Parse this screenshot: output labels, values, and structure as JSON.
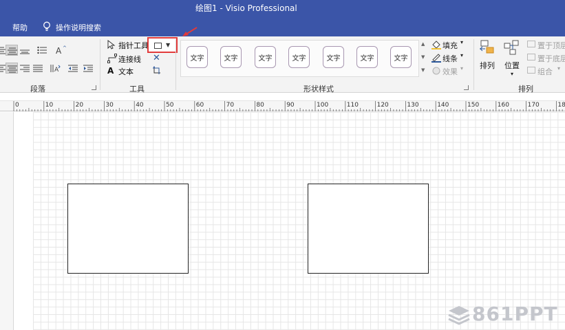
{
  "window": {
    "title": "绘图1  -  Visio Professional"
  },
  "menu": {
    "help": "帮助",
    "tell_me": "操作说明搜索"
  },
  "ribbon": {
    "paragraph": {
      "label": "段落"
    },
    "tools": {
      "label": "工具",
      "pointer": "指针工具",
      "connector": "连接线",
      "text": "文本",
      "text_glyph": "A"
    },
    "shape_styles": {
      "label": "形状样式",
      "tiles": [
        "文字",
        "文字",
        "文字",
        "文字",
        "文字",
        "文字",
        "文字"
      ],
      "fill": "填充",
      "line": "线条",
      "effects": "效果"
    },
    "arrange": {
      "label": "排列",
      "arrange_btn": "排列",
      "position_btn": "位置",
      "bring_front": "置于顶层",
      "send_back": "置于底层",
      "group": "组合"
    }
  },
  "ruler": {
    "labels": [
      "0",
      "10",
      "20",
      "30",
      "40",
      "50",
      "60",
      "70",
      "80",
      "90",
      "100",
      "110",
      "120",
      "130",
      "140",
      "150",
      "160",
      "170",
      "180"
    ]
  },
  "watermark": {
    "text": "861PPT"
  },
  "colors": {
    "brand": "#3b55a8",
    "highlight": "#e23a3a",
    "accent_blue": "#2b579a"
  }
}
